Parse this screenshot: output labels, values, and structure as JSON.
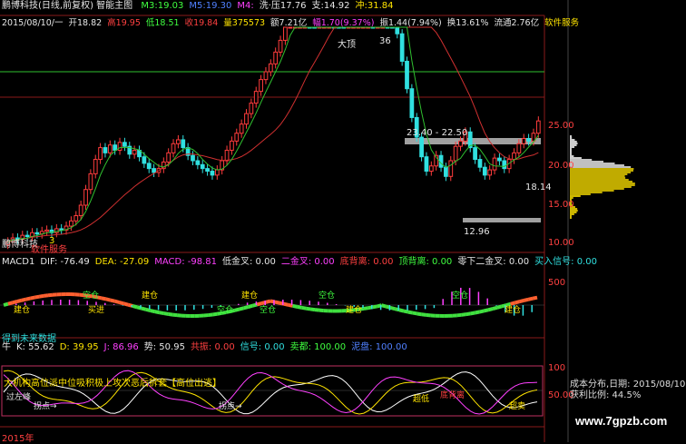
{
  "header": {
    "title": "鹏博科技(日线,前复权) 智能主图",
    "ma_items": [
      {
        "label": "M3:",
        "value": "19.03",
        "color": "#40ff40"
      },
      {
        "label": "M5:",
        "value": "19.30",
        "color": "#5080ff"
      },
      {
        "label": "M4:",
        "value": "",
        "color": "#ff40ff"
      },
      {
        "label": "洗·压",
        "value": "17.76",
        "color": "#e6e6e6"
      },
      {
        "label": "支:",
        "value": "14.92",
        "color": "#e6e6e6"
      },
      {
        "label": "冲:",
        "value": "31.84",
        "color": "#ffe400"
      }
    ]
  },
  "quote": {
    "date": "2015/08/10/一",
    "open": "开18.82",
    "high": "高19.95",
    "low": "低18.51",
    "close": "收19.84",
    "volume": "量375573",
    "amount": "额7.21亿",
    "change": "幅1.70(9.37%)",
    "amplitude": "振1.44(7.94%)",
    "turnover": "换13.61%",
    "float_cap": "流通2.76亿",
    "sector": "软件服务"
  },
  "price_panel": {
    "y_ticks": [
      "25.00",
      "20.00",
      "15.00",
      "10.00"
    ],
    "annotations": {
      "peak_label": "36",
      "top_tag": "大顶",
      "range_label": "23.40 - 22.50",
      "last_price": "18.14",
      "low_label": "12.96",
      "stock_name": "鹏博科技",
      "sector_tag": "软件服务",
      "counter": "3"
    }
  },
  "macd_panel": {
    "header": [
      {
        "text": "MACD1",
        "color": "#e6e6e6"
      },
      {
        "text": "DIF: -76.49",
        "color": "#e6e6e6"
      },
      {
        "text": "DEA: -27.09",
        "color": "#ffe400"
      },
      {
        "text": "MACD: -98.81",
        "color": "#ff40ff"
      },
      {
        "text": "低金叉: 0.00",
        "color": "#e6e6e6"
      },
      {
        "text": "二金叉: 0.00",
        "color": "#ff40ff"
      },
      {
        "text": "底背离: 0.00",
        "color": "#ff4040"
      },
      {
        "text": "顶背离: 0.00",
        "color": "#40ff40"
      },
      {
        "text": "零下二金叉: 0.00",
        "color": "#e6e6e6"
      },
      {
        "text": "买入信号: 0.00",
        "color": "#30e0e0"
      }
    ],
    "y_tick": "500",
    "signals": [
      "建仓",
      "空仓",
      "买进",
      "建仓",
      "空仓",
      "建仓",
      "空仓",
      "空仓",
      "建仓",
      "空仓",
      "建仓"
    ]
  },
  "kdj_panel": {
    "note": "得到未来数据",
    "header": [
      {
        "text": "牛",
        "color": "#e6e6e6"
      },
      {
        "text": "K: 55.62",
        "color": "#e6e6e6"
      },
      {
        "text": "D: 39.95",
        "color": "#ffe400"
      },
      {
        "text": "J: 86.96",
        "color": "#ff40ff"
      },
      {
        "text": "势: 50.95",
        "color": "#e6e6e6"
      },
      {
        "text": "共振: 0.00",
        "color": "#ff4040"
      },
      {
        "text": "信号: 0.00",
        "color": "#30e0e0"
      },
      {
        "text": "卖都: 100.00",
        "color": "#40ff40"
      },
      {
        "text": "泥盘: 100.00",
        "color": "#5080ff"
      }
    ],
    "banner": "大机构高位派中位吸积极上攻次恶后拆套【高位出逃】",
    "y_ticks": [
      "100",
      "50.00"
    ],
    "labels": [
      "过左峰",
      "拐点→",
      "拐点→",
      "超低",
      "底背离",
      "超卖"
    ]
  },
  "footer": {
    "year_label": "2015年"
  },
  "distribution": {
    "label1": "成本分布,日期: 2015/08/10",
    "label2": "获利比例: 44.5%",
    "website": "www.7gpzb.com"
  },
  "colors": {
    "up": "#ff3c3c",
    "down": "#30e0e0",
    "ma_short": "#ffffff",
    "ma_long": "#30c030",
    "macd_pos": "#ff6030",
    "macd_neg": "#40e040",
    "dist": "#ffe400"
  },
  "chart_data": {
    "type": "candlestick",
    "price_range": [
      10,
      27
    ],
    "closes": [
      10.6,
      10.9,
      10.8,
      11.1,
      11.0,
      11.3,
      11.2,
      11.4,
      11.5,
      11.3,
      11.6,
      11.5,
      11.8,
      12.2,
      12.6,
      13.4,
      14.6,
      15.8,
      16.9,
      17.8,
      17.4,
      18.0,
      17.6,
      18.2,
      17.9,
      17.3,
      17.6,
      17.1,
      16.6,
      16.2,
      15.9,
      16.2,
      16.7,
      17.4,
      18.1,
      18.4,
      17.8,
      17.2,
      16.8,
      16.5,
      16.2,
      16.0,
      15.7,
      16.1,
      16.8,
      17.6,
      18.3,
      18.9,
      19.6,
      20.4,
      21.2,
      22.1,
      23.0,
      23.6,
      24.2,
      25.1,
      26.0,
      27.6,
      29.0,
      30.4,
      31.2,
      31.8,
      30.6,
      28.9,
      29.8,
      30.9,
      32.1,
      31.0,
      29.6,
      28.2,
      29.3,
      30.5,
      31.8,
      33.0,
      34.2,
      33.0,
      35.0,
      36.0,
      33.5,
      29.0,
      26.5,
      24.4,
      22.3,
      20.1,
      18.6,
      17.1,
      16.0,
      16.4,
      17.2,
      16.3,
      15.6,
      16.8,
      17.9,
      18.3,
      19.0,
      17.8,
      16.9,
      16.3,
      15.7,
      16.1,
      17.0,
      16.8,
      16.2,
      16.9,
      17.4,
      18.1,
      18.5,
      18.3,
      18.9,
      19.84
    ]
  }
}
